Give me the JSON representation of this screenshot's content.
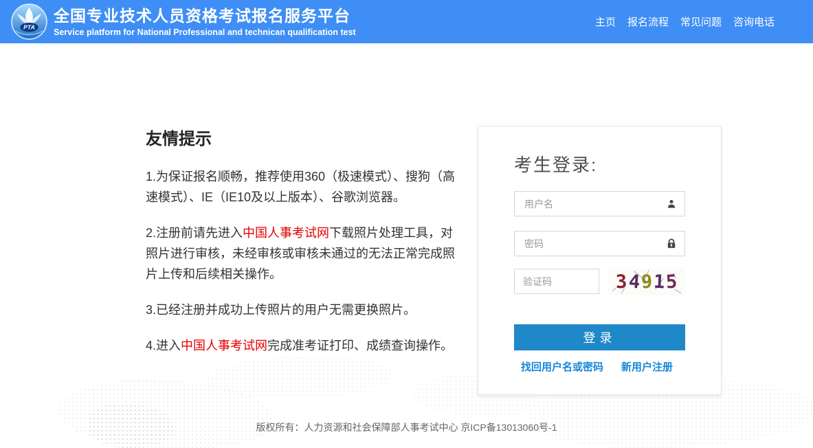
{
  "header": {
    "title": "全国专业技术人员资格考试报名服务平台",
    "subtitle": "Service platform for National Professional and technican qualification test",
    "logo_text": "PTA",
    "background_color": "#3E8EF5",
    "nav": [
      {
        "label": "主页"
      },
      {
        "label": "报名流程"
      },
      {
        "label": "常见问题"
      },
      {
        "label": "咨询电话"
      }
    ]
  },
  "tips": {
    "heading": "友情提示",
    "paragraphs": [
      {
        "segments": [
          {
            "text": "1.为保证报名顺畅，推荐使用360（极速模式）、搜狗（高速模式）、IE（IE10及以上版本）、谷歌浏览器。",
            "style": "normal"
          }
        ]
      },
      {
        "segments": [
          {
            "text": "2.注册前请先进入",
            "style": "normal"
          },
          {
            "text": "中国人事考试网",
            "style": "red-link"
          },
          {
            "text": "下载照片处理工具，对照片进行审核，未经审核或审核未通过的无法正常完成照片上传和后续相关操作。",
            "style": "normal"
          }
        ]
      },
      {
        "segments": [
          {
            "text": "3.已经注册并成功上传照片的用户无需更换照片。",
            "style": "normal"
          }
        ]
      },
      {
        "segments": [
          {
            "text": "4.进入",
            "style": "normal"
          },
          {
            "text": "中国人事考试网",
            "style": "red-link"
          },
          {
            "text": "完成准考证打印、成绩查询操作。",
            "style": "normal"
          }
        ]
      }
    ]
  },
  "login": {
    "heading": "考生登录:",
    "username_placeholder": "用户名",
    "password_placeholder": "密码",
    "captcha": {
      "placeholder": "验证码",
      "code": "34915",
      "digits": [
        {
          "char": "3",
          "color": "#8a2133",
          "rotate": -3
        },
        {
          "char": "4",
          "color": "#5a2a63",
          "rotate": 4
        },
        {
          "char": "9",
          "color": "#8f8a1e",
          "rotate": -2
        },
        {
          "char": "1",
          "color": "#5a2a63",
          "rotate": 3
        },
        {
          "char": "5",
          "color": "#6e2a52",
          "rotate": -4
        }
      ]
    },
    "button_label": "登录",
    "button_color": "#1f88c9",
    "forgot_label": "找回用户名或密码",
    "register_label": "新用户注册",
    "link_color": "#1787d9"
  },
  "footer": {
    "copyright": "版权所有：人力资源和社会保障部人事考试中心 京ICP备13013060号-1"
  }
}
